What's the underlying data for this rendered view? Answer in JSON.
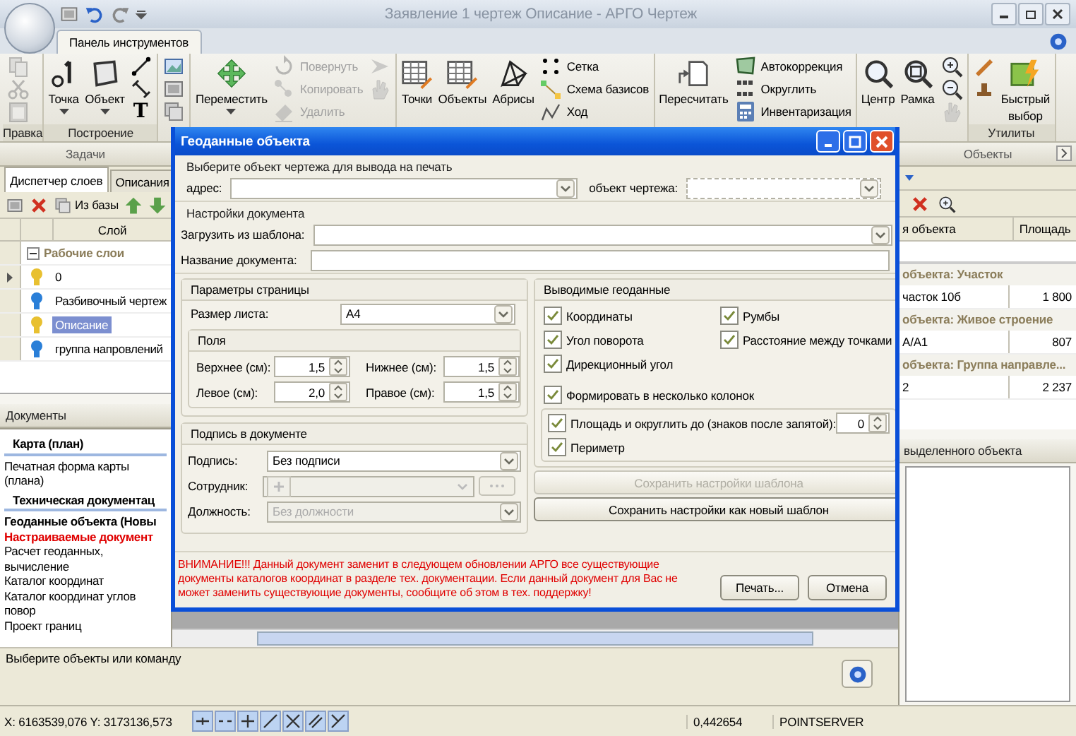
{
  "window": {
    "title": "Заявление 1 чертеж Описание - АРГО Чертеж"
  },
  "ribbon": {
    "tabs": [
      {
        "label": "Панель инструментов",
        "selected": true
      }
    ],
    "groups": [
      {
        "label": "Правка",
        "columns": [
          {
            "kind": "stack",
            "items": [
              {
                "kind": "icon",
                "disabled": true
              },
              {
                "kind": "icon",
                "disabled": true
              },
              {
                "kind": "icon",
                "disabled": true
              }
            ]
          }
        ]
      },
      {
        "label": "Построение",
        "columns": [
          {
            "kind": "large",
            "label": "Точка",
            "menu": true,
            "disabled": false
          },
          {
            "kind": "large",
            "label": "Объект",
            "menu": true,
            "disabled": false
          },
          {
            "kind": "stack",
            "items": [
              {
                "kind": "icon",
                "disabled": false
              },
              {
                "kind": "icon",
                "disabled": false
              },
              {
                "kind": "glyph",
                "text": "T",
                "disabled": false
              }
            ]
          }
        ]
      },
      {
        "columns": [
          {
            "kind": "stack",
            "items": [
              {
                "kind": "icon",
                "disabled": false
              },
              {
                "kind": "icon",
                "disabled": false
              },
              {
                "kind": "icon",
                "disabled": false
              }
            ]
          }
        ]
      },
      {
        "columns": [
          {
            "kind": "large",
            "label": "Переместить",
            "menu": true,
            "disabled": false
          },
          {
            "kind": "stack",
            "items": [
              {
                "kind": "icon",
                "label": "Повернуть",
                "disabled": true
              },
              {
                "kind": "icon",
                "label": "Копировать",
                "disabled": true
              },
              {
                "kind": "icon",
                "label": "Удалить",
                "disabled": true
              }
            ]
          },
          {
            "kind": "stack",
            "items": [
              {
                "kind": "icon",
                "disabled": true
              },
              {
                "kind": "icon",
                "disabled": true
              }
            ]
          }
        ]
      },
      {
        "columns": [
          {
            "kind": "large",
            "label": "Точки",
            "menu": false,
            "disabled": false
          },
          {
            "kind": "large",
            "label": "Объекты",
            "menu": false,
            "disabled": false
          },
          {
            "kind": "large",
            "label": "Абрисы",
            "menu": false,
            "disabled": false
          },
          {
            "kind": "stack",
            "items": [
              {
                "kind": "icon",
                "label": "Сетка",
                "disabled": false
              },
              {
                "kind": "icon",
                "label": "Схема базисов",
                "disabled": false
              },
              {
                "kind": "icon",
                "label": "Ход",
                "disabled": false
              }
            ]
          }
        ]
      },
      {
        "columns": [
          {
            "kind": "large",
            "label": "Пересчитать",
            "menu": false,
            "disabled": false
          },
          {
            "kind": "stack",
            "items": [
              {
                "kind": "icon",
                "label": "Автокоррекция",
                "disabled": false
              },
              {
                "kind": "icon",
                "label": "Округлить",
                "disabled": false
              },
              {
                "kind": "icon",
                "label": "Инвентаризация",
                "disabled": false
              }
            ]
          }
        ]
      },
      {
        "columns": [
          {
            "kind": "large",
            "label": "Центр",
            "menu": false,
            "disabled": false
          },
          {
            "kind": "large",
            "label": "Рамка",
            "menu": false,
            "disabled": false
          },
          {
            "kind": "stack",
            "items": [
              {
                "kind": "icon",
                "disabled": false
              },
              {
                "kind": "icon",
                "disabled": false
              },
              {
                "kind": "icon",
                "disabled": true
              }
            ]
          }
        ]
      },
      {
        "label": "Утилиты",
        "columns": [
          {
            "kind": "stack",
            "items": [
              {
                "kind": "icon",
                "disabled": false
              },
              {
                "kind": "icon",
                "disabled": false
              }
            ]
          },
          {
            "kind": "large",
            "label": "Быстрый выбор",
            "menu": false,
            "disabled": false
          }
        ]
      }
    ]
  },
  "tasks": {
    "title": "Задачи",
    "tabs": [
      {
        "label": "Диспетчер слоев",
        "selected": true
      },
      {
        "label": "Описания",
        "selected": false
      }
    ],
    "from_db": "Из базы",
    "column": "Слой",
    "group": {
      "label": "Рабочие слои",
      "expanded": true
    },
    "layers": [
      {
        "name": "0",
        "color": "#e8c030",
        "current": true,
        "selected": false
      },
      {
        "name": "Разбивочный чертеж",
        "color": "#2a7fd8",
        "current": false,
        "selected": false
      },
      {
        "name": "Описание",
        "color": "#e8c030",
        "current": false,
        "selected": true
      },
      {
        "name": "группа напровлений",
        "color": "#2a7fd8",
        "current": false,
        "selected": false
      }
    ]
  },
  "documents": {
    "title": "Документы",
    "items": [
      {
        "kind": "heading",
        "text": "Карта (план)"
      },
      {
        "kind": "plain",
        "text": "Печатная форма карты (плана)"
      },
      {
        "kind": "heading",
        "text": "Техническая документац"
      },
      {
        "kind": "bold",
        "text": "Геоданные объекта (Новы"
      },
      {
        "kind": "alert",
        "text": "Настраиваемые документ"
      },
      {
        "kind": "plain",
        "text": "Расчет геоданных, вычисление"
      },
      {
        "kind": "plain",
        "text": "Каталог координат"
      },
      {
        "kind": "plain",
        "text": "Каталог координат углов повор"
      },
      {
        "kind": "plain",
        "text": "Проект границ"
      }
    ]
  },
  "objects": {
    "title": "Объекты",
    "columns": [
      "я объекта",
      "Площадь"
    ],
    "groups": [
      {
        "title": "объекта: Участок",
        "rows": [
          {
            "name": "часток 10б",
            "area": "1 800"
          }
        ]
      },
      {
        "title": "объекта: Живое строение",
        "rows": [
          {
            "name": "А/А1",
            "area": "807"
          }
        ]
      },
      {
        "title": "объекта: Группа направле...",
        "rows": [
          {
            "name": "2",
            "area": "2 237"
          }
        ]
      }
    ],
    "details_title": "выделенного объекта"
  },
  "status_line": "Выберите объекты или команду",
  "status_bar": {
    "coords": "X: 6163539,076 Y: 3173136,573",
    "snaps": [
      {
        "on": true
      },
      {
        "on": true
      },
      {
        "on": true
      },
      {
        "on": true
      },
      {
        "on": true
      },
      {
        "on": true
      },
      {
        "on": true
      }
    ],
    "scale": "0,442654",
    "server": "POINTSERVER"
  },
  "dialog": {
    "title": "Геоданные объекта",
    "target": {
      "heading": "Выберите объект чертежа для вывода на печать",
      "address_label": "адрес:",
      "object_label": "объект чертежа:"
    },
    "settings": {
      "heading": "Настройки документа",
      "template_label": "Загрузить из шаблона:",
      "name_label": "Название документа:"
    },
    "page": {
      "heading": "Параметры страницы",
      "size_label": "Размер листа:",
      "size": "A4",
      "margins_heading": "Поля",
      "margins": [
        {
          "label": "Верхнее (см):",
          "value": "1,5"
        },
        {
          "label": "Нижнее (см):",
          "value": "1,5"
        },
        {
          "label": "Левое (см):",
          "value": "2,0"
        },
        {
          "label": "Правое (см):",
          "value": "1,5"
        }
      ]
    },
    "signature": {
      "heading": "Подпись в документе",
      "fields": [
        {
          "kind": "combo",
          "label": "Подпись:",
          "value": "Без подписи",
          "disabled": false
        },
        {
          "kind": "picker",
          "label": "Сотрудник:",
          "disabled": true
        },
        {
          "kind": "combo",
          "label": "Должность:",
          "value": "Без должности",
          "disabled": true
        }
      ]
    },
    "output": {
      "heading": "Выводимые геоданные",
      "options": [
        {
          "label": "Координаты",
          "checked": true
        },
        {
          "label": "Румбы",
          "checked": true
        },
        {
          "label": "Угол поворота",
          "checked": true
        },
        {
          "label": "Расстояние между точками",
          "checked": true
        },
        {
          "label": "Дирекционный угол",
          "checked": true
        }
      ],
      "columns": {
        "label": "Формировать в несколько колонок",
        "checked": true
      },
      "area": {
        "label": "Площадь и округлить до (знаков после запятой):",
        "checked": true,
        "value": "0"
      },
      "perimeter": {
        "label": "Периметр",
        "checked": true
      }
    },
    "buttons": [
      {
        "label": "Сохранить настройки шаблона",
        "disabled": true
      },
      {
        "label": "Сохранить настройки как новый шаблон",
        "disabled": false
      }
    ],
    "warning": "ВНИМАНИЕ!!! Данный документ заменит в следующем обновлении АРГО все существующие документы каталогов координат в разделе тех. документации. Если данный документ для Вас не может заменить существующие документы, сообщите об этом в тех. поддержку!",
    "actions": [
      {
        "label": "Печать..."
      },
      {
        "label": "Отмена"
      }
    ]
  }
}
